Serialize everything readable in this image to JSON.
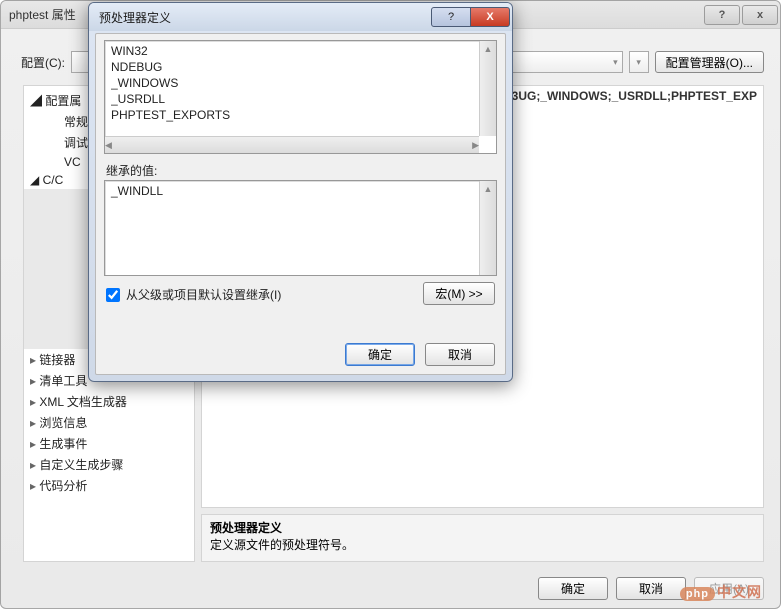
{
  "outer": {
    "title": "phptest 属性",
    "help_glyph": "?",
    "close_glyph": "x",
    "config_label": "配置(C):",
    "config_mgr_btn": "配置管理器(O)...",
    "dropdown_glyph": "▾",
    "tree": {
      "root": "配置属",
      "general": "常规",
      "debug": "调试",
      "vc": "VC",
      "cc": "C/C",
      "linker": "链接器",
      "manifest": "清单工具",
      "xmldoc": "XML 文档生成器",
      "browse": "浏览信息",
      "buildevt": "生成事件",
      "custom": "自定义生成步骤",
      "codean": "代码分析"
    },
    "right_line": "3UG;_WINDOWS;_USRDLL;PHPTEST_EXP",
    "desc_title": "预处理器定义",
    "desc_body": "定义源文件的预处理符号。",
    "footer": {
      "ok": "确定",
      "cancel": "取消",
      "apply": "应用(A)"
    }
  },
  "modal": {
    "title": "预处理器定义",
    "help_glyph": "?",
    "close_glyph": "X",
    "defs": [
      "WIN32",
      "NDEBUG",
      "_WINDOWS",
      "_USRDLL",
      "PHPTEST_EXPORTS"
    ],
    "inherit_label": "继承的值:",
    "inherited": [
      "_WINDLL"
    ],
    "checkbox_label": "从父级或项目默认设置继承(I)",
    "checkbox_checked": true,
    "macro_btn": "宏(M) >>",
    "ok": "确定",
    "cancel": "取消",
    "scroll": {
      "up": "▲",
      "down": "▼",
      "left": "◀",
      "right": "▶"
    }
  },
  "watermark": {
    "pill": "php",
    "rest": "中文网"
  }
}
